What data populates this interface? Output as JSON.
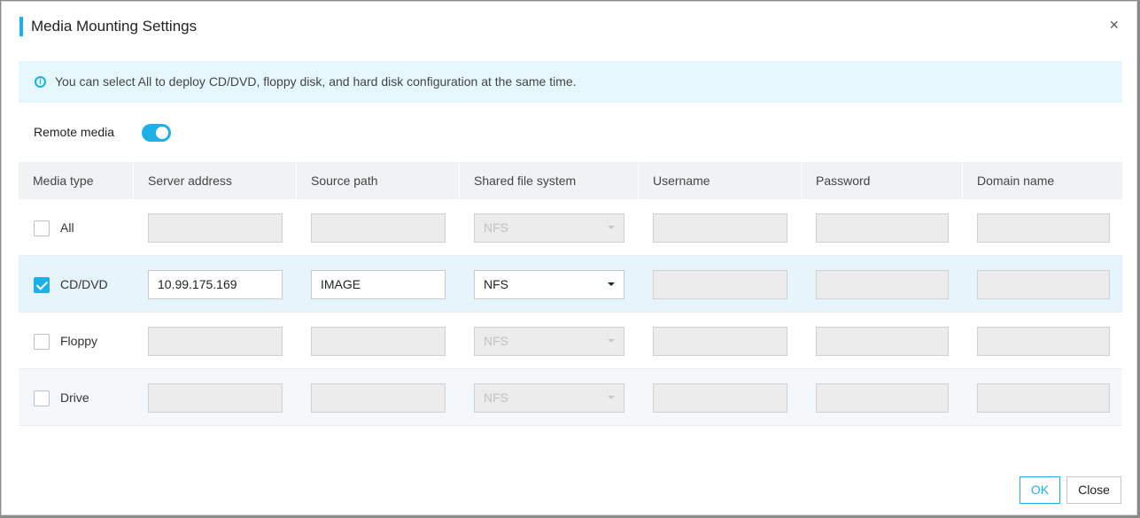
{
  "dialog": {
    "title": "Media Mounting Settings",
    "close_glyph": "×"
  },
  "info": {
    "icon_glyph": "i",
    "text": "You can select All to deploy CD/DVD, floppy disk, and hard disk configuration at the same time."
  },
  "remote_media": {
    "label": "Remote media",
    "enabled": true
  },
  "table": {
    "headers": [
      "Media type",
      "Server address",
      "Source path",
      "Shared file system",
      "Username",
      "Password",
      "Domain name"
    ],
    "rows": [
      {
        "label": "All",
        "checked": false,
        "server": "",
        "source": "",
        "fs": "NFS",
        "username": "",
        "password": "",
        "domain": ""
      },
      {
        "label": "CD/DVD",
        "checked": true,
        "server": "10.99.175.169",
        "source": "IMAGE",
        "fs": "NFS",
        "username": "",
        "password": "",
        "domain": ""
      },
      {
        "label": "Floppy",
        "checked": false,
        "server": "",
        "source": "",
        "fs": "NFS",
        "username": "",
        "password": "",
        "domain": ""
      },
      {
        "label": "Drive",
        "checked": false,
        "server": "",
        "source": "",
        "fs": "NFS",
        "username": "",
        "password": "",
        "domain": ""
      }
    ]
  },
  "footer": {
    "ok_label": "OK",
    "close_label": "Close"
  },
  "colors": {
    "accent": "#1bb0e8",
    "info_bg": "#e6f7fd",
    "selected_row_bg": "#e6f5fc",
    "disabled_field_bg": "#ececec"
  }
}
